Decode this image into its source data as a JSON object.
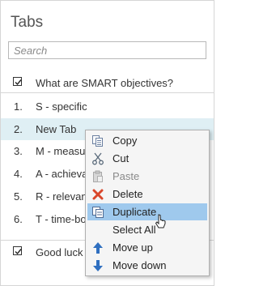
{
  "panel": {
    "title": "Tabs",
    "search": {
      "placeholder": "Search",
      "value": ""
    },
    "header_item": {
      "checked": true,
      "label": "What are SMART objectives?"
    },
    "items": [
      {
        "num": "1.",
        "label": "S - specific"
      },
      {
        "num": "2.",
        "label": "New Tab",
        "selected": true
      },
      {
        "num": "3.",
        "label": "M - measu"
      },
      {
        "num": "4.",
        "label": "A - achieva"
      },
      {
        "num": "5.",
        "label": "R - relevan"
      },
      {
        "num": "6.",
        "label": "T - time-bo"
      }
    ],
    "footer_item": {
      "checked": true,
      "label": "Good luck"
    }
  },
  "context_menu": {
    "items": [
      {
        "label": "Copy",
        "icon": "copy-icon",
        "enabled": true
      },
      {
        "label": "Cut",
        "icon": "scissors-icon",
        "enabled": true
      },
      {
        "label": "Paste",
        "icon": "clipboard-icon",
        "enabled": false
      },
      {
        "label": "Delete",
        "icon": "red-x-icon",
        "enabled": true
      },
      {
        "label": "Duplicate",
        "icon": "duplicate-icon",
        "enabled": true,
        "hover": true
      },
      {
        "label": "Select All",
        "icon": "",
        "enabled": true
      },
      {
        "label": "Move up",
        "icon": "arrow-up-icon",
        "enabled": true
      },
      {
        "label": "Move down",
        "icon": "arrow-down-icon",
        "enabled": true
      }
    ]
  },
  "colors": {
    "selected_row": "#dfeff4",
    "menu_hover": "#9fc9ed",
    "delete_red": "#d9472b",
    "arrow_blue": "#2f6fc0"
  }
}
